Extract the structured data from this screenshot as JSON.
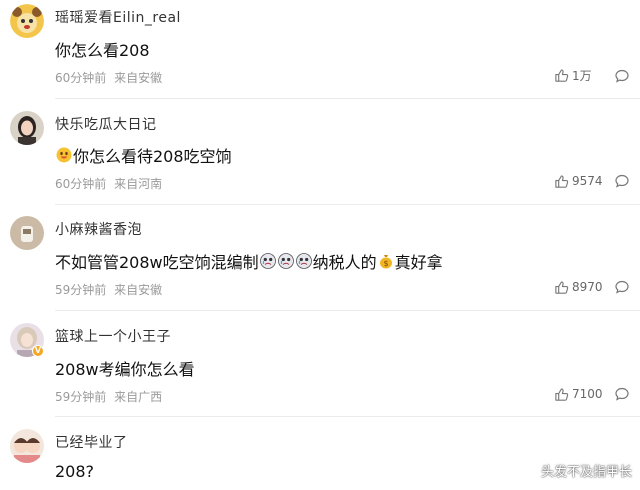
{
  "comments": [
    {
      "username": "瑶瑶爱看Eilin_real",
      "text": "你怎么看208",
      "time": "60分钟前",
      "location": "来自安徽",
      "likes": "1万"
    },
    {
      "username": "快乐吃瓜大日记",
      "text": "你怎么看待208吃空饷",
      "time": "60分钟前",
      "location": "来自河南",
      "likes": "9574",
      "emoji_before": "happy-face-emoji"
    },
    {
      "username": "小麻辣酱香泡",
      "text_a": "不如管管208w吃空饷混编制",
      "text_b": "纳税人的",
      "text_c": "真好拿",
      "time": "59分钟前",
      "location": "来自安徽",
      "likes": "8970"
    },
    {
      "username": "篮球上一个小王子",
      "text": "208w考编你怎么看",
      "time": "59分钟前",
      "location": "来自广西",
      "likes": "7100",
      "verified_badge": "V"
    },
    {
      "username": "已经毕业了",
      "text": "208?"
    }
  ],
  "watermark": "头发不及指甲长",
  "colors": {
    "meta": "#9a9a9a",
    "badge": "#f5a623",
    "divider": "#ececec"
  },
  "icons": {
    "like": "thumbs-up-icon",
    "reply": "comment-bubble-icon"
  }
}
